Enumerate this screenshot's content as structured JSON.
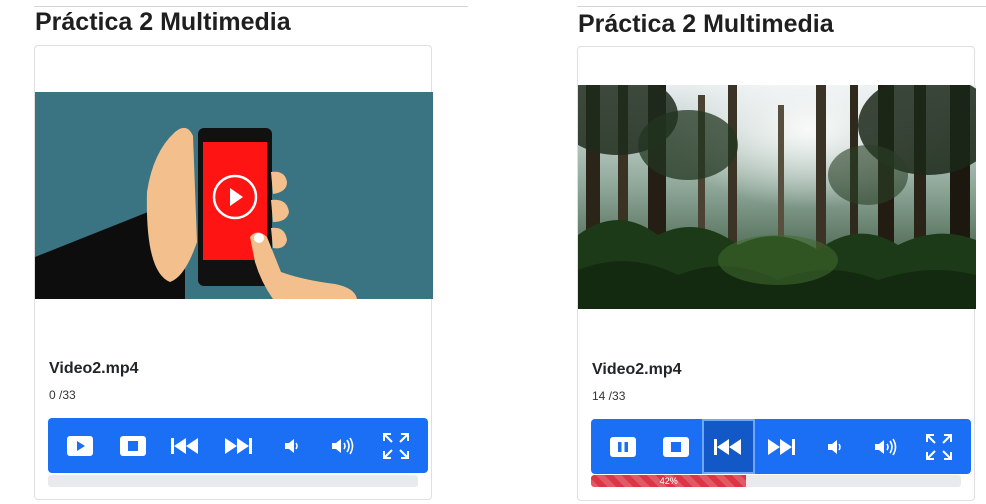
{
  "colors": {
    "accent": "#1a6ff5",
    "progress_fill": "#dc3545",
    "progress_track": "#e8eaed"
  },
  "left_player": {
    "title": "Práctica 2 Multimedia",
    "filename": "Video2.mp4",
    "time": "0 /33",
    "controls": [
      {
        "name": "play-button",
        "icon": "play-icon"
      },
      {
        "name": "stop-button",
        "icon": "stop-icon"
      },
      {
        "name": "rewind-button",
        "icon": "rewind-icon"
      },
      {
        "name": "fast-forward-button",
        "icon": "fast-forward-icon"
      },
      {
        "name": "volume-down-button",
        "icon": "volume-down-icon"
      },
      {
        "name": "volume-up-button",
        "icon": "volume-up-icon"
      },
      {
        "name": "fullscreen-button",
        "icon": "fullscreen-icon"
      }
    ],
    "progress": {
      "percent": 0,
      "label": ""
    }
  },
  "right_player": {
    "title": "Práctica 2 Multimedia",
    "filename": "Video2.mp4",
    "time": "14 /33",
    "controls": [
      {
        "name": "pause-button",
        "icon": "pause-icon"
      },
      {
        "name": "stop-button",
        "icon": "stop-icon"
      },
      {
        "name": "rewind-button",
        "icon": "rewind-icon",
        "active": true
      },
      {
        "name": "fast-forward-button",
        "icon": "fast-forward-icon"
      },
      {
        "name": "volume-down-button",
        "icon": "volume-down-icon"
      },
      {
        "name": "volume-up-button",
        "icon": "volume-up-icon"
      },
      {
        "name": "fullscreen-button",
        "icon": "fullscreen-icon"
      }
    ],
    "progress": {
      "percent": 42,
      "label": "42%"
    }
  }
}
